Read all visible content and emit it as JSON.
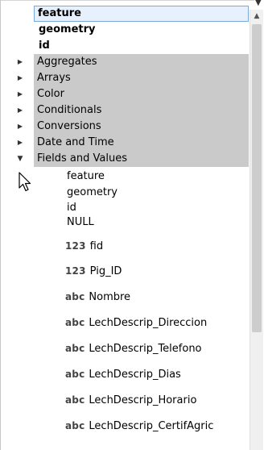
{
  "tree": {
    "top_items": [
      "feature",
      "geometry",
      "id"
    ],
    "groups": [
      {
        "label": "Aggregates",
        "expanded": false
      },
      {
        "label": "Arrays",
        "expanded": false
      },
      {
        "label": "Color",
        "expanded": false
      },
      {
        "label": "Conditionals",
        "expanded": false
      },
      {
        "label": "Conversions",
        "expanded": false
      },
      {
        "label": "Date and Time",
        "expanded": false
      },
      {
        "label": "Fields and Values",
        "expanded": true
      }
    ],
    "fields_children_plain": [
      "feature",
      "geometry",
      "id",
      "NULL"
    ],
    "fields_children_typed": [
      {
        "type": "123",
        "name": "fid"
      },
      {
        "type": "123",
        "name": "Pig_ID"
      },
      {
        "type": "abc",
        "name": "Nombre"
      },
      {
        "type": "abc",
        "name": "LechDescrip_Direccion"
      },
      {
        "type": "abc",
        "name": "LechDescrip_Telefono"
      },
      {
        "type": "abc",
        "name": "LechDescrip_Dias"
      },
      {
        "type": "abc",
        "name": "LechDescrip_Horario"
      },
      {
        "type": "abc",
        "name": "LechDescrip_CertifAgric"
      }
    ]
  },
  "icons": {
    "collapsed": "triangle-right-icon",
    "expanded": "triangle-down-icon",
    "cursor": "mouse-pointer-icon",
    "scroll_up": "scroll-up-arrow-icon"
  },
  "colors": {
    "group_bg": "#cacaca",
    "selected_bg": "#e7f1fd",
    "selected_border": "#7ba8d8"
  }
}
